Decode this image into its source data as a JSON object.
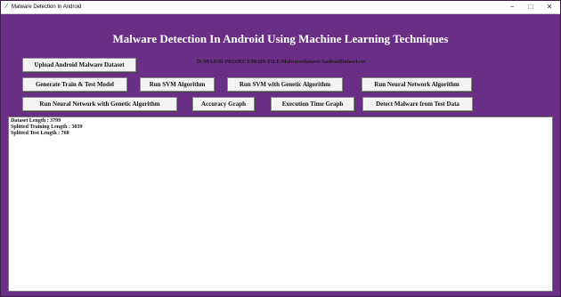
{
  "window": {
    "title": "Malware Detection In Android",
    "controls": {
      "minimize": "−",
      "maximize": "□",
      "close": "✕"
    }
  },
  "heading": "Malware Detection In Android Using Machine Learning Techniques",
  "dataset_path": "D:/MAJOR PROJECT/MAIN FILE/Malware/dataset/AndroidDataset.csv",
  "buttons": {
    "upload": "Upload Android Malware Dataset",
    "generate": "Generate Train & Test Model",
    "svm": "Run SVM Algorithm",
    "svm_ga": "Run SVM with Genetic Algorithm",
    "nn": "Run Neural Network Algorithm",
    "nn_ga": "Run Neural Network with Genetic Algorithm",
    "accuracy": "Accuracy Graph",
    "exec_time": "Execution Time Graph",
    "detect": "Detect Malware from Test Data"
  },
  "console": {
    "lines": [
      "Dataset Length : 3799",
      "Splitted Training Length : 3039",
      "Splitted Test Length : 760"
    ]
  },
  "colors": {
    "background": "#6a2f84",
    "heading_text": "#ffffff"
  }
}
